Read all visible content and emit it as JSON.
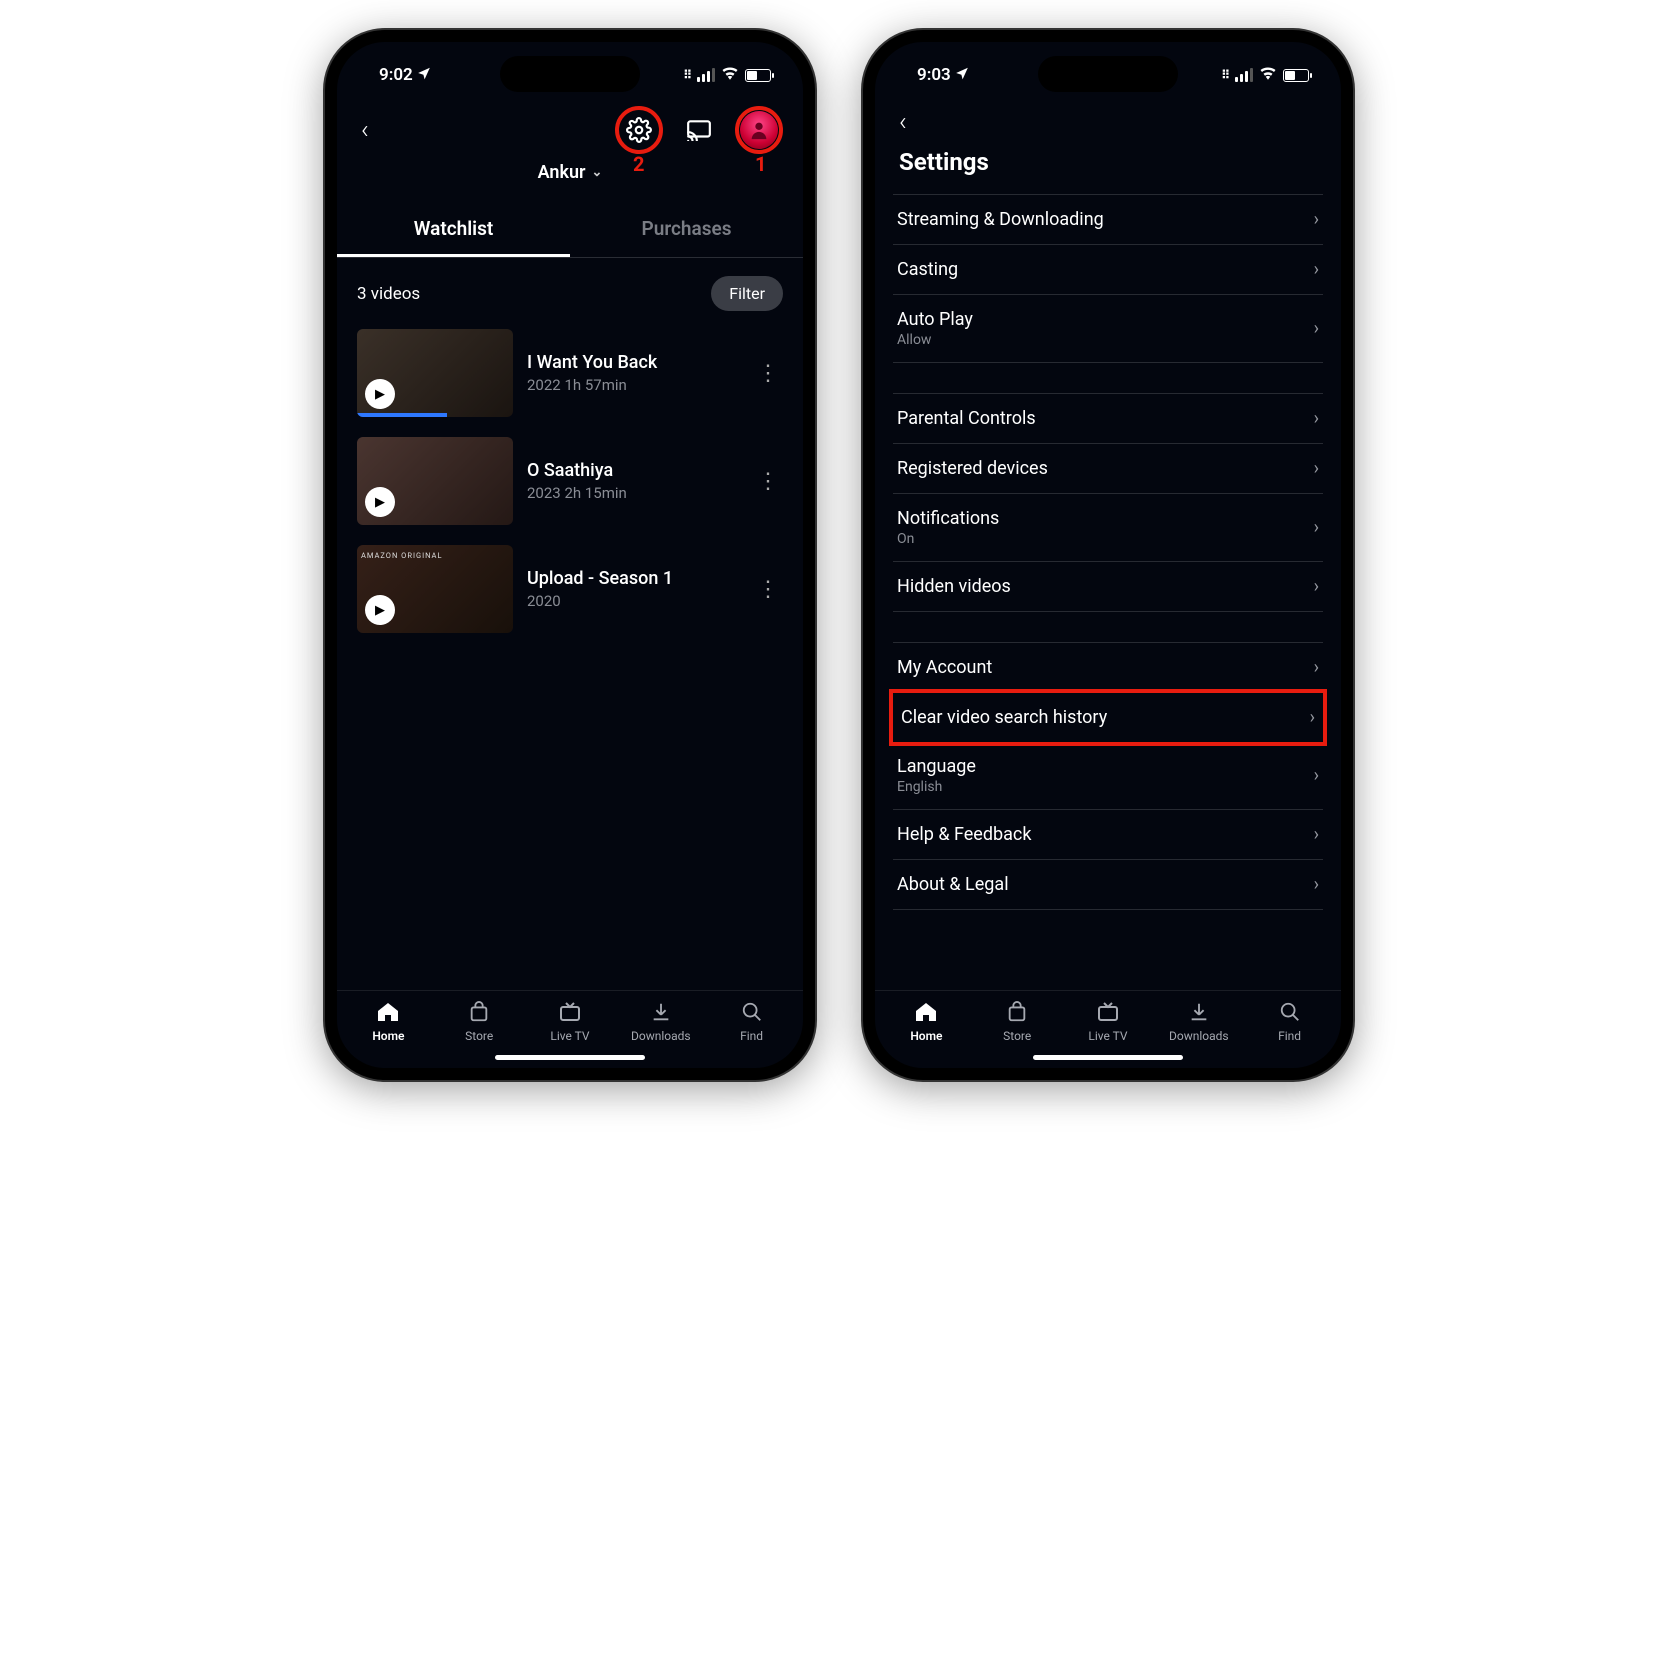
{
  "left": {
    "status": {
      "time": "9:02"
    },
    "annotations": {
      "settings_num": "2",
      "avatar_num": "1"
    },
    "profile_name": "Ankur",
    "tabs": {
      "watchlist": "Watchlist",
      "purchases": "Purchases"
    },
    "count_label": "3 videos",
    "filter_label": "Filter",
    "videos": [
      {
        "title": "I Want You Back",
        "meta": "2022 1h 57min",
        "progress_pct": 58,
        "tag": ""
      },
      {
        "title": "O Saathiya",
        "meta": "2023 2h 15min",
        "progress_pct": 0,
        "tag": ""
      },
      {
        "title": "Upload - Season 1",
        "meta": "2020",
        "progress_pct": 0,
        "tag": "AMAZON ORIGINAL"
      }
    ]
  },
  "right": {
    "status": {
      "time": "9:03"
    },
    "title": "Settings",
    "group1": [
      {
        "label": "Streaming & Downloading",
        "sub": ""
      },
      {
        "label": "Casting",
        "sub": ""
      },
      {
        "label": "Auto Play",
        "sub": "Allow"
      }
    ],
    "group2": [
      {
        "label": "Parental Controls",
        "sub": ""
      },
      {
        "label": "Registered devices",
        "sub": ""
      },
      {
        "label": "Notifications",
        "sub": "On"
      },
      {
        "label": "Hidden videos",
        "sub": ""
      }
    ],
    "group3": [
      {
        "label": "My Account",
        "sub": "",
        "highlight": false
      },
      {
        "label": "Clear video search history",
        "sub": "",
        "highlight": true
      },
      {
        "label": "Language",
        "sub": "English",
        "highlight": false
      },
      {
        "label": "Help & Feedback",
        "sub": "",
        "highlight": false
      },
      {
        "label": "About & Legal",
        "sub": "",
        "highlight": false
      }
    ]
  },
  "tabbar": [
    {
      "label": "Home",
      "active": true
    },
    {
      "label": "Store",
      "active": false
    },
    {
      "label": "Live TV",
      "active": false
    },
    {
      "label": "Downloads",
      "active": false
    },
    {
      "label": "Find",
      "active": false
    }
  ]
}
